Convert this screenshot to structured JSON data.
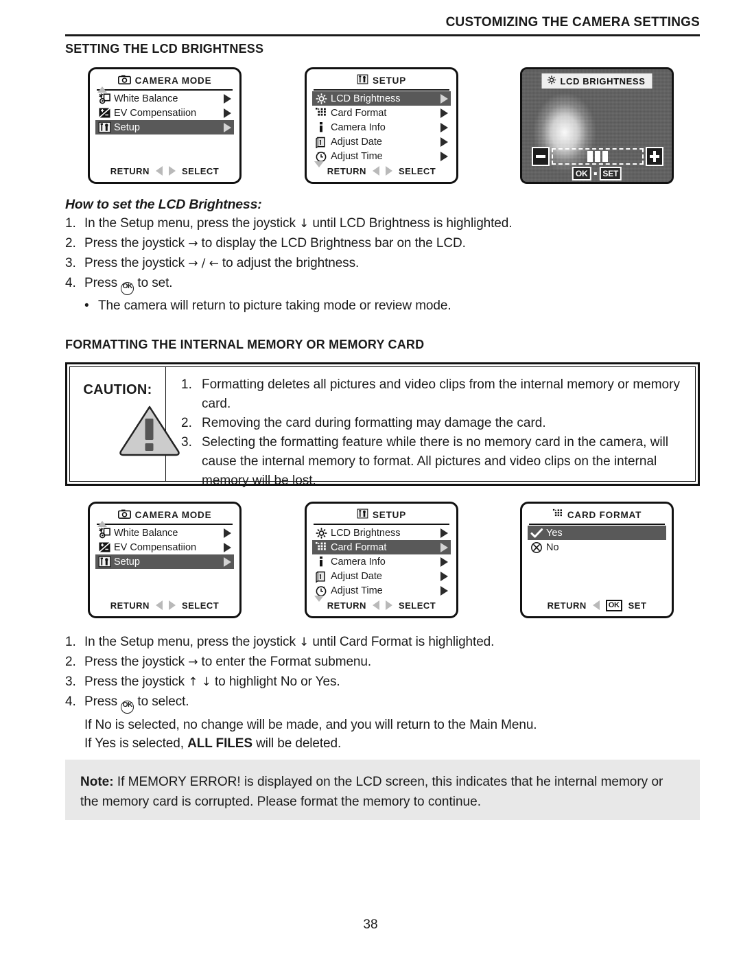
{
  "header": {
    "running_title": "CUSTOMIZING THE CAMERA SETTINGS"
  },
  "sections": {
    "lcd_brightness_title": "SETTING THE LCD BRIGHTNESS",
    "formatting_title": "FORMATTING THE INTERNAL MEMORY OR MEMORY CARD"
  },
  "screens": {
    "camera_mode": {
      "title": "CAMERA MODE",
      "title_icon": "camera-icon",
      "rows": [
        {
          "icon": "white-balance-icon",
          "label": "White Balance",
          "selected": false
        },
        {
          "icon": "ev-compensation-icon",
          "label": "EV Compensatiion",
          "selected": false
        },
        {
          "icon": "setup-tools-icon",
          "label": "Setup",
          "selected": true
        }
      ],
      "footer_left": "RETURN",
      "footer_right": "SELECT"
    },
    "setup_brightness": {
      "title": "SETUP",
      "title_icon": "setup-tools-icon",
      "rows": [
        {
          "icon": "sun-icon",
          "label": "LCD Brightness",
          "selected": true
        },
        {
          "icon": "card-format-icon",
          "label": "Card Format",
          "selected": false
        },
        {
          "icon": "info-icon",
          "label": "Camera Info",
          "selected": false
        },
        {
          "icon": "calendar-icon",
          "label": "Adjust Date",
          "selected": false
        },
        {
          "icon": "clock-icon",
          "label": "Adjust Time",
          "selected": false
        }
      ],
      "footer_left": "RETURN",
      "footer_right": "SELECT"
    },
    "setup_card_format": {
      "title": "SETUP",
      "title_icon": "setup-tools-icon",
      "rows": [
        {
          "icon": "sun-icon",
          "label": "LCD Brightness",
          "selected": false
        },
        {
          "icon": "card-format-icon",
          "label": "Card Format",
          "selected": true
        },
        {
          "icon": "info-icon",
          "label": "Camera Info",
          "selected": false
        },
        {
          "icon": "calendar-icon",
          "label": "Adjust Date",
          "selected": false
        },
        {
          "icon": "clock-icon",
          "label": "Adjust Time",
          "selected": false
        }
      ],
      "footer_left": "RETURN",
      "footer_right": "SELECT"
    },
    "lcd_brightness_preview": {
      "title": "LCD BRIGHTNESS",
      "title_icon": "sun-icon",
      "minus_label": "minus-button",
      "plus_label": "plus-button",
      "bar_segments": 3,
      "ok_label": "OK",
      "set_label": "SET"
    },
    "card_format": {
      "title": "CARD FORMAT",
      "title_icon": "card-format-icon",
      "rows": [
        {
          "icon": "check-icon",
          "label": "Yes",
          "selected": true
        },
        {
          "icon": "circle-x-icon",
          "label": "No",
          "selected": false
        }
      ],
      "footer_left": "RETURN",
      "footer_ok": "OK",
      "footer_right": "SET"
    }
  },
  "howto": {
    "heading": "How to set the LCD Brightness:",
    "steps": [
      {
        "num": "1.",
        "pre": "In the Setup menu, press the joystick ",
        "glyph": "↓",
        "post": " until LCD Brightness is highlighted."
      },
      {
        "num": "2.",
        "pre": "Press the joystick ",
        "glyph": "→",
        "post": " to display the LCD Brightness bar on the LCD."
      },
      {
        "num": "3.",
        "pre": "Press the joystick ",
        "glyph": "→ / ←",
        "post": " to adjust the brightness."
      },
      {
        "num": "4.",
        "pre": "Press ",
        "glyph": "OK",
        "post": " to set."
      }
    ],
    "bullet": "The camera will return to picture taking mode or review mode.",
    "bullet_mark": "•"
  },
  "caution": {
    "word": "CAUTION:",
    "icon": "warning-triangle-icon",
    "items": [
      {
        "num": "1.",
        "text": "Formatting deletes all pictures and video clips from the internal memory or memory card."
      },
      {
        "num": "2.",
        "text": "Removing the card during formatting may damage the card."
      },
      {
        "num": "3.",
        "text": "Selecting the formatting feature while there is no memory card in the camera, will cause the internal memory to format.  All pictures and video clips on the internal memory will be lost."
      }
    ]
  },
  "format_steps": {
    "steps": [
      {
        "num": "1.",
        "pre": "In the Setup menu, press the joystick ",
        "glyph": "↓",
        "post": " until Card Format is highlighted."
      },
      {
        "num": "2.",
        "pre": "Press the joystick ",
        "glyph": "→",
        "post": " to enter the Format submenu."
      },
      {
        "num": "3.",
        "pre": "Press the joystick ",
        "glyph": "↑ ↓",
        "post": " to highlight No or Yes."
      },
      {
        "num": "4.",
        "pre": "Press ",
        "glyph": "OK",
        "post": " to select."
      }
    ],
    "line_no": "If No is selected, no change will be made, and you will return to the Main Menu.",
    "line_yes_pre": "If Yes is selected, ",
    "line_yes_bold": "ALL FILES",
    "line_yes_post": " will be deleted."
  },
  "note": {
    "label": "Note:",
    "text": " If MEMORY ERROR! is displayed on the LCD screen, this indicates that he internal memory or the memory card is corrupted. Please format the memory to continue."
  },
  "page_number": "38",
  "colors": {
    "selection": "#595959",
    "note_bg": "#e8e8e8",
    "caution_fill": "#cccccc"
  }
}
